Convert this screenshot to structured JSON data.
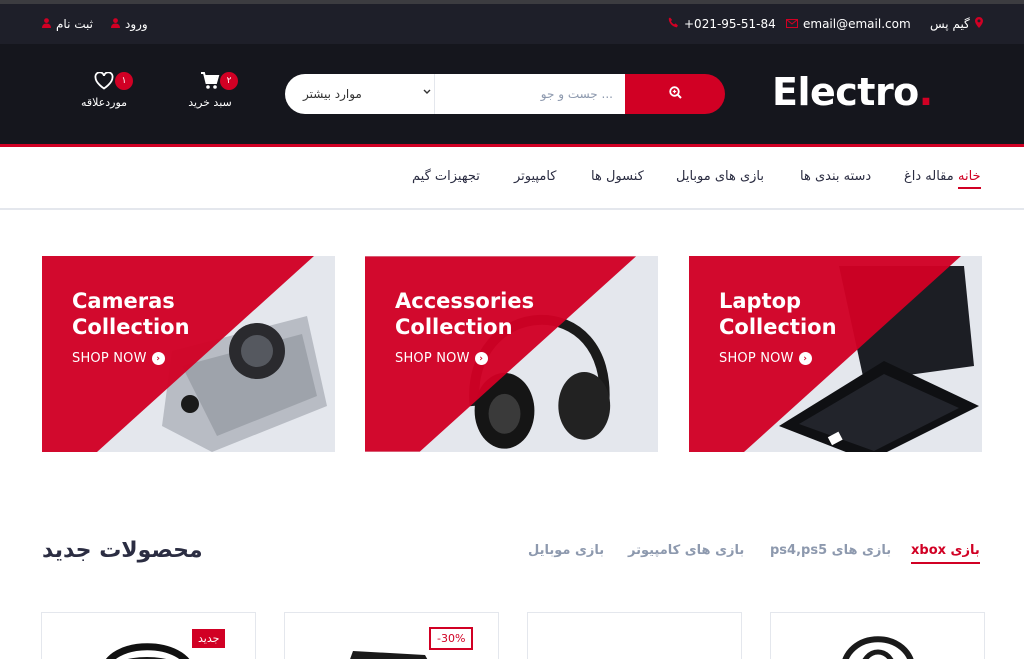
{
  "topbar": {
    "brand": "گیم پس",
    "email": "email@email.com",
    "phone": "+021-95-51-84",
    "login": "ورود",
    "register": "ثبت نام"
  },
  "header": {
    "logo_text": "Electro",
    "logo_dot": ".",
    "search_category": "موارد بیشتر",
    "search_placeholder": "... جست و جو",
    "cart_label": "سبد خرید",
    "cart_count": "۲",
    "wishlist_label": "موردعلاقه",
    "wishlist_count": "۱"
  },
  "nav": {
    "items": [
      "خانه",
      "مقاله داغ",
      "دسته بندی ها",
      "بازی های موبایل",
      "کنسول ها",
      "کامپیوتر",
      "تجهیزات گیم"
    ],
    "active": "خانه"
  },
  "banners": [
    {
      "title": "Laptop\nCollection",
      "cta": "SHOP NOW"
    },
    {
      "title": "Accessories\nCollection",
      "cta": "SHOP NOW"
    },
    {
      "title": "Cameras\nCollection",
      "cta": "SHOP NOW"
    }
  ],
  "products_section": {
    "title": "محصولات جدید",
    "tabs": [
      "xbox بازی",
      "ps4,ps5 بازی های",
      "بازی های کامپیوتر",
      "بازی موبایل"
    ]
  },
  "cards": [
    {
      "label": "جدید"
    },
    {
      "label": "-30%"
    },
    {
      "label": ""
    },
    {
      "label": ""
    }
  ],
  "colors": {
    "accent": "#d10024",
    "header_bg": "#15161d",
    "topbar_bg": "#1e1f29"
  }
}
